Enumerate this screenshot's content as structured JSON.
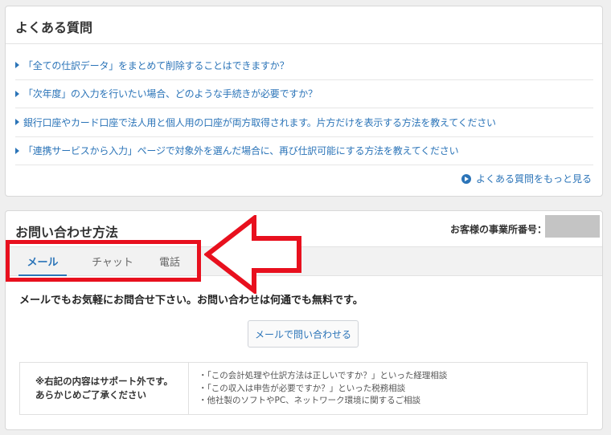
{
  "faq": {
    "title": "よくある質問",
    "items": [
      "「全ての仕訳データ」をまとめて削除することはできますか？",
      "「次年度」の入力を行いたい場合、どのような手続きが必要ですか？",
      "銀行口座やカード口座で法人用と個人用の口座が両方取得されます。片方だけを表示する方法を教えてください",
      "「連携サービスから入力」ページで対象外を選んだ場合に、再び仕訳可能にする方法を教えてください"
    ],
    "more_link": "よくある質問をもっと見る"
  },
  "contact": {
    "title": "お問い合わせ方法",
    "office_number_label": "お客様の事業所番号：",
    "office_number_value": "",
    "tabs": [
      {
        "label": "メール",
        "active": true
      },
      {
        "label": "チャット",
        "active": false
      },
      {
        "label": "電話",
        "active": false
      }
    ],
    "mail": {
      "lead": "メールでもお気軽にお問合せ下さい。お問い合わせは何通でも無料です。",
      "button_label": "メールで問い合わせる"
    },
    "notice": {
      "left_line1": "※右記の内容はサポート外です。",
      "left_line2": "あらかじめご了承ください",
      "items": [
        "・「この会計処理や仕訳方法は正しいですか？」といった経理相談",
        "・「この収入は申告が必要ですか？」といった税務相談",
        "・他社製のソフトやPC、ネットワーク環境に関するご相談"
      ]
    }
  },
  "colors": {
    "link": "#2b74b8",
    "annotation": "#e8101e",
    "page_bg": "#efefef",
    "masked_value": "#c4c4c4"
  }
}
